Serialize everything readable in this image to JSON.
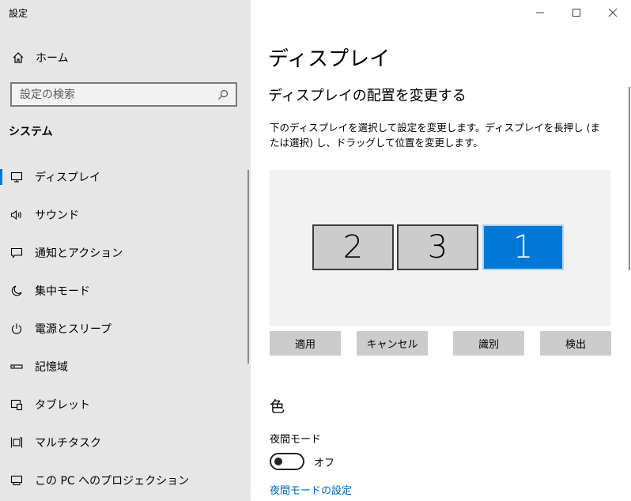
{
  "app": {
    "title": "設定"
  },
  "sidebar": {
    "home_label": "ホーム",
    "search_placeholder": "設定の検索",
    "section_title": "システム",
    "items": [
      {
        "label": "ディスプレイ",
        "icon": "monitor-icon",
        "active": true
      },
      {
        "label": "サウンド",
        "icon": "speaker-icon"
      },
      {
        "label": "通知とアクション",
        "icon": "message-icon"
      },
      {
        "label": "集中モード",
        "icon": "moon-icon"
      },
      {
        "label": "電源とスリープ",
        "icon": "power-icon"
      },
      {
        "label": "記憶域",
        "icon": "storage-icon"
      },
      {
        "label": "タブレット",
        "icon": "tablet-icon"
      },
      {
        "label": "マルチタスク",
        "icon": "multitask-icon"
      },
      {
        "label": "この PC へのプロジェクション",
        "icon": "projection-icon"
      }
    ]
  },
  "main": {
    "page_title": "ディスプレイ",
    "section_title": "ディスプレイの配置を変更する",
    "description": "下のディスプレイを選択して設定を変更します。ディスプレイを長押し (または選択) し、ドラッグして位置を変更します。",
    "monitors": [
      {
        "label": "2",
        "selected": false
      },
      {
        "label": "3",
        "selected": false
      },
      {
        "label": "1",
        "selected": true
      }
    ],
    "buttons": {
      "apply": "適用",
      "cancel": "キャンセル",
      "identify": "識別",
      "detect": "検出"
    },
    "color_section": {
      "title": "色",
      "night_mode_label": "夜間モード",
      "night_mode_state": "オフ",
      "night_mode_settings_link": "夜間モードの設定"
    }
  },
  "colors": {
    "accent": "#0078d7",
    "sidebar_bg": "#e6e6e6",
    "link": "#0067c0"
  }
}
